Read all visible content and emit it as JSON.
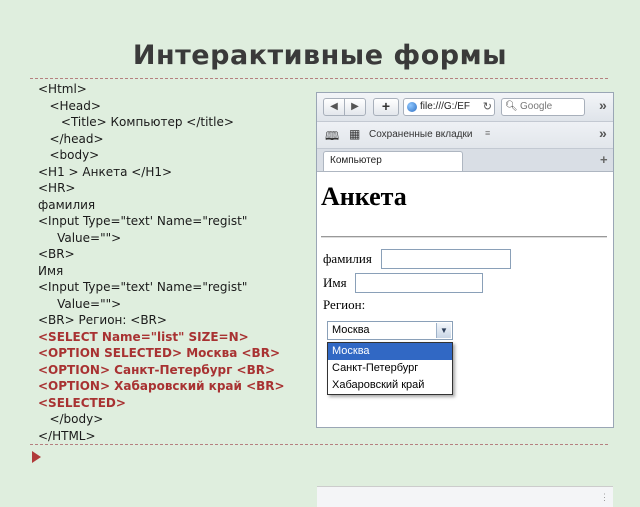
{
  "slide": {
    "title": "Интерактивные формы",
    "code_lines": [
      {
        "text": "<Html>",
        "hl": false
      },
      {
        "text": "   <Head>",
        "hl": false
      },
      {
        "text": "      <Title> Компьютер </title>",
        "hl": false
      },
      {
        "text": "   </head>",
        "hl": false
      },
      {
        "text": "   <body>",
        "hl": false
      },
      {
        "text": "<H1 > Анкета </H1>",
        "hl": false
      },
      {
        "text": "<HR>",
        "hl": false
      },
      {
        "text": "фамилия",
        "hl": false
      },
      {
        "text": "<Input Type=\"text' Name=\"regist\"\n     Value=\"\">",
        "hl": false
      },
      {
        "text": "<BR>",
        "hl": false
      },
      {
        "text": "Имя",
        "hl": false
      },
      {
        "text": "<Input Type=\"text' Name=\"regist\"\n     Value=\"\">",
        "hl": false
      },
      {
        "text": "<BR> Регион: <BR>",
        "hl": false
      },
      {
        "text": "<SELECT Name=\"list\" SIZE=N>",
        "hl": true
      },
      {
        "text": "<OPTION SELECTED> Москва <BR>",
        "hl": true
      },
      {
        "text": "<OPTION> Санкт-Петербург <BR>",
        "hl": true
      },
      {
        "text": "<OPTION> Хабаровский край <BR>",
        "hl": true
      },
      {
        "text": "<SELECTED>",
        "hl": true
      },
      {
        "text": "   </body>",
        "hl": false
      },
      {
        "text": "</HTML>",
        "hl": false
      }
    ]
  },
  "browser": {
    "nav": {
      "back_glyph": "◀",
      "forward_glyph": "▶",
      "add_glyph": "+",
      "url": "file:///G:/EF",
      "reload_glyph": "↻",
      "search_placeholder": "Google",
      "overflow_glyph": "»"
    },
    "bookmarks": {
      "label": "Сохраненные вкладки",
      "book_icon": "book-icon",
      "grid_icon": "grid-icon"
    },
    "tab": {
      "title": "Компьютер",
      "new_tab_glyph": "+"
    },
    "page": {
      "heading": "Анкета",
      "surname_label": "фамилия",
      "name_label": "Имя",
      "region_label": "Регион:",
      "select_value": "Москва",
      "options": [
        "Москва",
        "Санкт-Петербург",
        "Хабаровский край"
      ],
      "selected_index": 0
    }
  },
  "colors": {
    "background": "#dfeede",
    "highlight_code": "#a83232",
    "selected_option": "#3168c4"
  }
}
